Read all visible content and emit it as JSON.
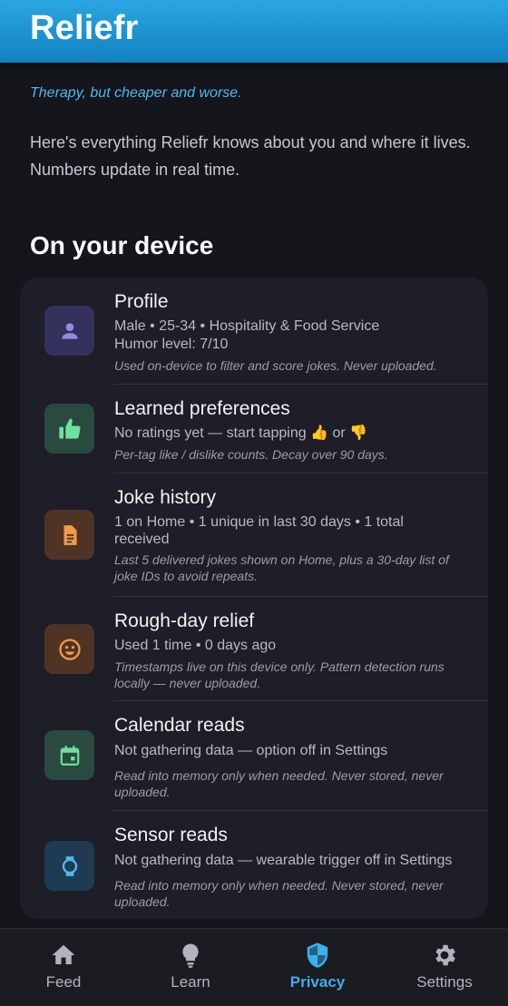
{
  "app": {
    "title": "Reliefr",
    "tagline": "Therapy, but cheaper and worse.",
    "intro": "Here's everything Reliefr knows about you and where it lives. Numbers update in real time."
  },
  "section": {
    "title": "On your device"
  },
  "items": [
    {
      "icon": "person-icon",
      "icon_bg": "#34325c",
      "icon_color": "#8f8be8",
      "title": "Profile",
      "detail": "Male • 25-34 • Hospitality & Food Service",
      "detail2": "Humor level: 7/10",
      "note": "Used on-device to filter and score jokes. Never uploaded."
    },
    {
      "icon": "thumbs-up-icon",
      "icon_bg": "#2a4a3f",
      "icon_color": "#6ee0a2",
      "title": "Learned preferences",
      "detail": "No ratings yet — start tapping 👍 or 👎",
      "note": "Per-tag like / dislike counts. Decay over 90 days."
    },
    {
      "icon": "document-icon",
      "icon_bg": "#4f3425",
      "icon_color": "#f09a4a",
      "title": "Joke history",
      "detail": "1 on Home • 1 unique in last 30 days • 1 total received",
      "note": "Last 5 delivered jokes shown on Home, plus a 30-day list of joke IDs to avoid repeats."
    },
    {
      "icon": "smiley-icon",
      "icon_bg": "#4f3425",
      "icon_color": "#f09a4a",
      "title": "Rough-day relief",
      "detail": "Used 1 time • 0 days ago",
      "note": "Timestamps live on this device only. Pattern detection runs locally — never uploaded."
    },
    {
      "icon": "calendar-icon",
      "icon_bg": "#2a4a3f",
      "icon_color": "#6ee0a2",
      "title": "Calendar reads",
      "detail": "Not gathering data — option off in Settings",
      "note": "Read into memory only when needed. Never stored, never uploaded."
    },
    {
      "icon": "watch-icon",
      "icon_bg": "#1e3b52",
      "icon_color": "#4fb8ee",
      "title": "Sensor reads",
      "detail": "Not gathering data — wearable trigger off in Settings",
      "note": "Read into memory only when needed. Never stored, never uploaded."
    }
  ],
  "nav": {
    "active": "Privacy",
    "items": [
      {
        "label": "Feed",
        "icon": "home-icon"
      },
      {
        "label": "Learn",
        "icon": "lightbulb-icon"
      },
      {
        "label": "Privacy",
        "icon": "shield-icon"
      },
      {
        "label": "Settings",
        "icon": "gear-icon"
      }
    ]
  },
  "colors": {
    "accent": "#3ab0ee",
    "background": "#15151c",
    "card": "#1e1e28"
  }
}
